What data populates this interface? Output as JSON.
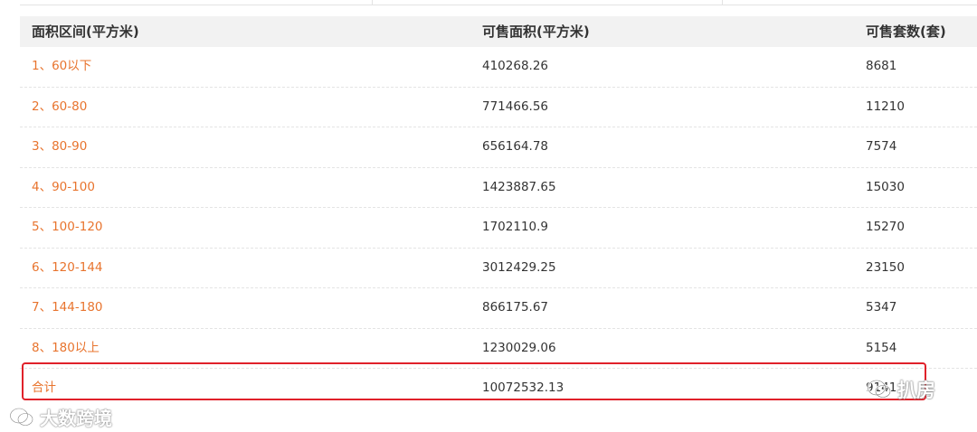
{
  "table": {
    "headers": {
      "area_range": "面积区间(平方米)",
      "saleable_area": "可售面积(平方米)",
      "saleable_units": "可售套数(套)"
    },
    "rows": [
      {
        "range": "1、60以下",
        "area": "410268.26",
        "units": "8681"
      },
      {
        "range": "2、60-80",
        "area": "771466.56",
        "units": "11210"
      },
      {
        "range": "3、80-90",
        "area": "656164.78",
        "units": "7574"
      },
      {
        "range": "4、90-100",
        "area": "1423887.65",
        "units": "15030"
      },
      {
        "range": "5、100-120",
        "area": "1702110.9",
        "units": "15270"
      },
      {
        "range": "6、120-144",
        "area": "3012429.25",
        "units": "23150"
      },
      {
        "range": "7、144-180",
        "area": "866175.67",
        "units": "5347"
      },
      {
        "range": "8、180以上",
        "area": "1230029.06",
        "units": "5154"
      }
    ],
    "total": {
      "label": "合计",
      "area": "10072532.13",
      "units": "9141"
    }
  },
  "watermarks": {
    "right": "扒房",
    "right_icon": "wechat-icon",
    "left": "大数跨境",
    "left_icon": "wechat-icon"
  },
  "colors": {
    "range_text": "#e8742e",
    "highlight_border": "#e0212a",
    "header_bg": "#f2f2f2"
  }
}
